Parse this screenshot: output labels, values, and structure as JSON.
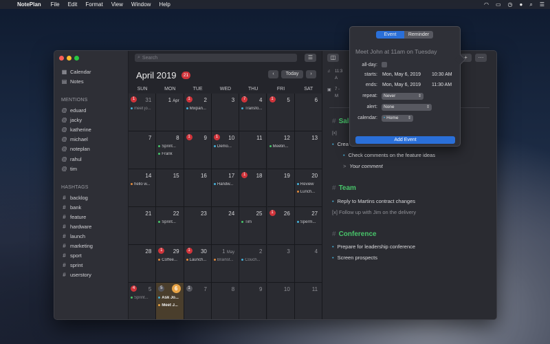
{
  "menubar": {
    "app": "NotePlan",
    "items": [
      "File",
      "Edit",
      "Format",
      "View",
      "Window",
      "Help"
    ]
  },
  "sidebar": {
    "top": [
      {
        "label": "Calendar",
        "icon": "calendar-icon"
      },
      {
        "label": "Notes",
        "icon": "notes-icon"
      }
    ],
    "mentions_title": "MENTIONS",
    "mentions": [
      "eduard",
      "jacky",
      "katherine",
      "michael",
      "noteplan",
      "rahul",
      "tim"
    ],
    "hashtags_title": "HASHTAGS",
    "hashtags": [
      "backlog",
      "bank",
      "feature",
      "hardware",
      "launch",
      "marketing",
      "sport",
      "sprint",
      "userstory"
    ]
  },
  "calendar": {
    "search_placeholder": "Search",
    "month_title": "April 2019",
    "month_badge": "21",
    "today_label": "Today",
    "prev": "‹",
    "next": "›",
    "weekdays": [
      "SUN",
      "MON",
      "TUE",
      "WED",
      "THU",
      "FRI",
      "SAT"
    ],
    "weeks": [
      [
        {
          "day": "31",
          "dim": true,
          "badge": "1",
          "events": [
            {
              "t": "meet jo...",
              "c": "#45b1d8"
            }
          ]
        },
        {
          "day": "1",
          "month": "Apr",
          "badge": "",
          "events": []
        },
        {
          "day": "2",
          "badge": "1",
          "events": [
            {
              "t": "Mixpan...",
              "c": "#45b1d8"
            }
          ]
        },
        {
          "day": "3",
          "badge": "",
          "events": []
        },
        {
          "day": "4",
          "badge": "7",
          "events": [
            {
              "t": "Transfo...",
              "c": "#45b1d8"
            }
          ]
        },
        {
          "day": "5",
          "badge": "1",
          "events": []
        },
        {
          "day": "6",
          "badge": "",
          "events": []
        }
      ],
      [
        {
          "day": "7",
          "badge": "",
          "events": []
        },
        {
          "day": "8",
          "badge": "",
          "events": [
            {
              "t": "Sprint...",
              "c": "#48c46a"
            },
            {
              "t": "Frank",
              "c": "#48c46a"
            }
          ]
        },
        {
          "day": "9",
          "badge": "1",
          "events": []
        },
        {
          "day": "10",
          "badge": "1",
          "events": [
            {
              "t": "Demo...",
              "c": "#45b1d8"
            }
          ]
        },
        {
          "day": "11",
          "badge": "",
          "events": []
        },
        {
          "day": "12",
          "badge": "",
          "events": [
            {
              "t": "Meetin...",
              "c": "#48c46a"
            }
          ]
        },
        {
          "day": "13",
          "badge": "",
          "events": []
        }
      ],
      [
        {
          "day": "14",
          "badge": "",
          "events": [
            {
              "t": "hello w...",
              "c": "#e08a3c"
            }
          ]
        },
        {
          "day": "15",
          "badge": "",
          "events": []
        },
        {
          "day": "16",
          "badge": "",
          "events": []
        },
        {
          "day": "17",
          "badge": "",
          "events": [
            {
              "t": "Handw...",
              "c": "#45b1d8"
            }
          ]
        },
        {
          "day": "18",
          "badge": "1",
          "events": []
        },
        {
          "day": "19",
          "badge": "",
          "events": []
        },
        {
          "day": "20",
          "badge": "",
          "events": [
            {
              "t": "Review",
              "c": "#45b1d8"
            },
            {
              "t": "Lunch...",
              "c": "#e08a3c"
            }
          ]
        }
      ],
      [
        {
          "day": "21",
          "badge": "",
          "events": []
        },
        {
          "day": "22",
          "badge": "",
          "events": [
            {
              "t": "Sprint...",
              "c": "#48c46a"
            }
          ]
        },
        {
          "day": "23",
          "badge": "",
          "events": []
        },
        {
          "day": "24",
          "badge": "",
          "events": []
        },
        {
          "day": "25",
          "badge": "",
          "events": [
            {
              "t": "Tim",
              "c": "#48c46a"
            }
          ]
        },
        {
          "day": "26",
          "badge": "1",
          "events": []
        },
        {
          "day": "27",
          "badge": "",
          "events": [
            {
              "t": "Sperm...",
              "c": "#45b1d8"
            }
          ]
        }
      ],
      [
        {
          "day": "28",
          "badge": "",
          "events": []
        },
        {
          "day": "29",
          "badge": "1",
          "events": [
            {
              "t": "Coffee...",
              "c": "#e08a3c"
            }
          ]
        },
        {
          "day": "30",
          "badge": "1",
          "events": [
            {
              "t": "Launch...",
              "c": "#e08a3c"
            }
          ]
        },
        {
          "day": "1",
          "month": "May",
          "dim": true,
          "badge": "",
          "events": [
            {
              "t": "Brainst...",
              "c": "#e08a3c"
            }
          ]
        },
        {
          "day": "2",
          "dim": true,
          "badge": "",
          "events": [
            {
              "t": "Couch...",
              "c": "#45b1d8"
            }
          ]
        },
        {
          "day": "3",
          "dim": true,
          "badge": "",
          "events": []
        },
        {
          "day": "4",
          "dim": true,
          "badge": "",
          "events": []
        }
      ],
      [
        {
          "day": "5",
          "dim": true,
          "badge": "4",
          "events": [
            {
              "t": "Sprint...",
              "c": "#48c46a"
            }
          ]
        },
        {
          "day": "6",
          "today": true,
          "badge": "5",
          "gray": true,
          "events": [
            {
              "t": "Ask Jo...",
              "c": "#45b1d8",
              "bold": true
            },
            {
              "t": "Meet J...",
              "c": "#e8a446",
              "bold": true
            }
          ]
        },
        {
          "day": "7",
          "dim": true,
          "badge": "1",
          "gray": true,
          "events": []
        },
        {
          "day": "8",
          "dim": true,
          "badge": "",
          "events": []
        },
        {
          "day": "9",
          "dim": true,
          "badge": "",
          "events": []
        },
        {
          "day": "10",
          "dim": true,
          "badge": "",
          "events": []
        },
        {
          "day": "11",
          "dim": true,
          "badge": "",
          "events": []
        }
      ]
    ]
  },
  "note": {
    "frag1": "11:3",
    "frag2": "A",
    "frag3": "7 -",
    "frag4": "M",
    "sec1_title": "Sale",
    "line_x": "[x]",
    "line_crea": "Crea",
    "check_comments": "Check comments on the feature ideas",
    "your_comment": "Your comment",
    "team_title": "Team",
    "team_line1": "Reply to Martins contract changes",
    "team_line2": "[x]  Follow up with Jim on the delivery",
    "conf_title": "Conference",
    "conf_line1": "Prepare for leadership conference",
    "conf_line2": "Screen prospects"
  },
  "popover": {
    "tab_event": "Event",
    "tab_reminder": "Reminder",
    "title_placeholder": "Meet John at 11am on Tuesday",
    "allday_label": "all-day:",
    "starts_label": "starts:",
    "starts_date": "Mon, May 6, 2019",
    "starts_time": "10:30 AM",
    "ends_label": "ends:",
    "ends_date": "Mon, May 6, 2019",
    "ends_time": "11:30 AM",
    "repeat_label": "repeat:",
    "repeat_value": "Never",
    "alert_label": "alert:",
    "alert_value": "None",
    "calendar_label": "calendar:",
    "calendar_value": "Home",
    "add_button": "Add Event"
  }
}
